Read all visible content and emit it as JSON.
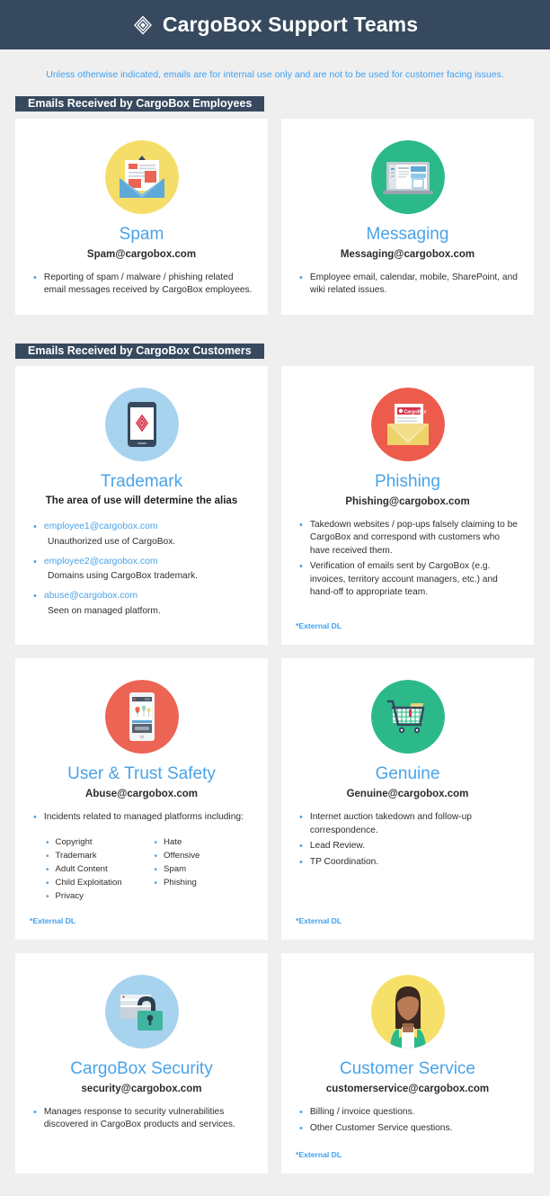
{
  "header": {
    "title": "CargoBox Support Teams",
    "logo_icon": "diamond-logo-icon",
    "bg_color": "#36495e"
  },
  "notice": {
    "text": "Unless otherwise indicated, emails are for internal use only and are not to be used for customer facing issues.",
    "color": "#3ea0f0"
  },
  "sections": [
    {
      "banner": "Emails Received by CargoBox Employees"
    },
    {
      "banner": "Emails Received by CargoBox Customers"
    }
  ],
  "external_label": "*External DL",
  "accent_blue": "#4aa3e8",
  "cards": {
    "spam": {
      "title": "Spam",
      "email": "Spam@cargobox.com",
      "icon": "open-envelope-document-icon",
      "circle_color": "#f5dd6a",
      "bullets": [
        "Reporting of spam / malware / phishing related email messages received by CargoBox employees."
      ]
    },
    "messaging": {
      "title": "Messaging",
      "email": "Messaging@cargobox.com",
      "icon": "laptop-screen-icon",
      "circle_color": "#2bb98a",
      "bullets": [
        "Employee email, calendar, mobile, SharePoint, and wiki related issues."
      ]
    },
    "trademark": {
      "title": "Trademark",
      "email": "",
      "subtitle": "The area of use will determine the alias",
      "icon": "tablet-logo-icon",
      "circle_color": "#a8d3ef",
      "aliases": [
        {
          "email": "employee1@cargobox.com",
          "desc": "Unauthorized use of CargoBox."
        },
        {
          "email": "employee2@cargobox.com",
          "desc": "Domains using CargoBox trademark."
        },
        {
          "email": "abuse@cargobox.com",
          "desc": "Seen on managed platform."
        }
      ]
    },
    "phishing": {
      "title": "Phishing",
      "email": "Phishing@cargobox.com",
      "icon": "envelope-letter-icon",
      "circle_color": "#ed5b4c",
      "bullets": [
        "Takedown websites / pop-ups falsely claiming to be CargoBox and correspond with customers who have received them.",
        "Verification of emails sent by CargoBox (e.g. invoices, territory account managers, etc.) and hand-off to appropriate team."
      ],
      "external": true
    },
    "user_trust_safety": {
      "title": "User & Trust Safety",
      "email": "Abuse@cargobox.com",
      "icon": "smartphone-icon",
      "circle_color": "#ec6453",
      "bullets": [
        "Incidents related to managed platforms including:"
      ],
      "sub_columns": [
        [
          "Copyright",
          "Trademark",
          "Adult Content",
          "Child Exploitation",
          "Privacy"
        ],
        [
          "Hate",
          "Offensive",
          "Spam",
          "Phishing"
        ]
      ],
      "external": true
    },
    "genuine": {
      "title": "Genuine",
      "email": "Genuine@cargobox.com",
      "icon": "shopping-cart-icon",
      "circle_color": "#2bb98a",
      "bullets": [
        "Internet auction takedown and follow-up correspondence.",
        "Lead Review.",
        "TP Coordination."
      ],
      "external": true
    },
    "security": {
      "title": "CargoBox Security",
      "email": "security@cargobox.com",
      "icon": "padlock-browser-icon",
      "circle_color": "#a8d3ef",
      "bullets": [
        "Manages response to security vulnerabilities discovered in CargoBox products and services."
      ]
    },
    "customer_service": {
      "title": "Customer Service",
      "email": "customerservice@cargobox.com",
      "icon": "person-avatar-icon",
      "circle_color": "#f7e06a",
      "bullets": [
        "Billing / invoice questions.",
        "Other Customer Service questions."
      ],
      "external": true
    }
  }
}
